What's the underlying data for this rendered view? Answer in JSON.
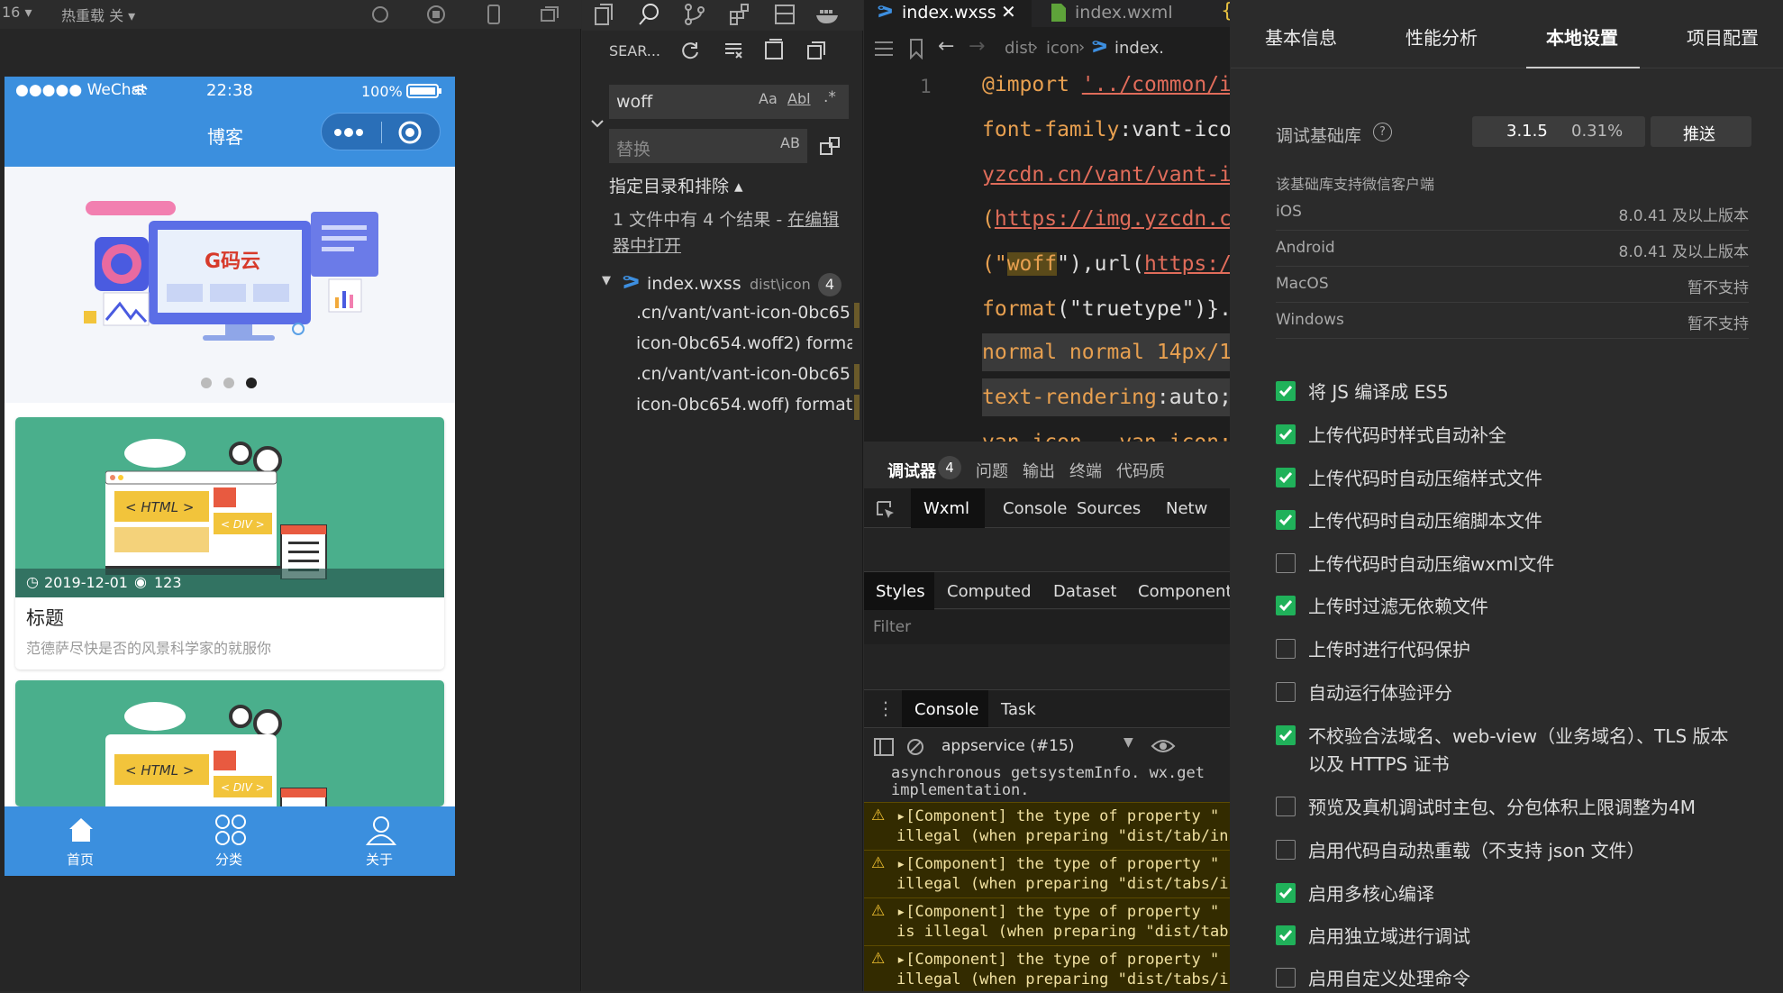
{
  "sim_toolbar": {
    "zoom": "16",
    "reload_label": "热重载 关"
  },
  "phone": {
    "carrier": "●●●●● WeChat",
    "time": "22:38",
    "battery": "100%",
    "nav_title": "博客",
    "carousel_dots": 3,
    "carousel_active": 3,
    "cards": [
      {
        "date": "2019-12-01",
        "views": "123",
        "title": "标题",
        "desc": "范德萨尽快是否的风景科学家的就服你",
        "html_tag": "< HTML >",
        "div_tag": "< DIV >"
      },
      {
        "html_tag": "< HTML >",
        "div_tag": "< DIV >"
      }
    ],
    "logo_text": "G码云",
    "tabbar": [
      {
        "label": "首页",
        "icon": "home-icon"
      },
      {
        "label": "分类",
        "icon": "grid-icon"
      },
      {
        "label": "关于",
        "icon": "user-icon"
      }
    ]
  },
  "search": {
    "header_label": "SEAR...",
    "query": "woff",
    "replace_placeholder": "替换",
    "opt_case": "Aa",
    "opt_word": "Abl",
    "opt_regex": ".*",
    "opt_preserve": "AB",
    "scope_label": "指定目录和排除",
    "summary": "1 文件中有 4 个结果 - ",
    "summary_link": "在编辑器中打开",
    "file_name": "index.wxss",
    "file_path": "dist\\icon",
    "file_count": "4",
    "results": [
      ".cn/vant/vant-icon-0bc65...",
      "icon-0bc654.woff2) forma...",
      ".cn/vant/vant-icon-0bc65...",
      "icon-0bc654.woff) format(..."
    ]
  },
  "editor": {
    "tabs": [
      {
        "label": "index.wxss",
        "active": true
      },
      {
        "label": "index.wxml",
        "active": false
      }
    ],
    "breadcrumb": [
      "dist",
      "icon",
      "index."
    ],
    "line_number": "1",
    "lines": [
      {
        "a": "@import ",
        "b": "'../common/i"
      },
      {
        "a": "font-family",
        "b": ":vant-ico"
      },
      {
        "a": "yzcdn.cn/vant/vant-i",
        "b": ""
      },
      {
        "a": "(",
        "b": "https://img.yzcdn.c"
      },
      {
        "a": "(\"",
        "b": "woff",
        "c": "\"),url(",
        "d": "https:/"
      },
      {
        "a": "format",
        "b": "(\"truetype\")}."
      },
      {
        "a": "normal normal 14px/1",
        "b": ""
      },
      {
        "a": "text-rendering",
        "b": ":auto;"
      },
      {
        "a": "van-icon, .van-icon:b",
        "b": ""
      }
    ]
  },
  "debugger": {
    "tabs": [
      "调试器",
      "问题",
      "输出",
      "终端",
      "代码质"
    ],
    "badge": "4",
    "subtabs": [
      "Wxml",
      "Console",
      "Sources",
      "Netw"
    ],
    "style_tabs": [
      "Styles",
      "Computed",
      "Dataset",
      "Component"
    ],
    "filter_placeholder": "Filter",
    "console_tabs": [
      "Console",
      "Task"
    ],
    "context": "appservice (#15)",
    "pre_line1": "asynchronous getsystemInfo. wx.get",
    "pre_line2": "implementation.",
    "warnings": [
      {
        "l1": "▸[Component] the type of property \"",
        "l2": "illegal (when preparing \"dist/tab/in"
      },
      {
        "l1": "▸[Component] the type of property \"",
        "l2": "illegal (when preparing \"dist/tabs/i"
      },
      {
        "l1": "▸[Component] the type of property \"",
        "l2": "is illegal (when preparing \"dist/tab"
      },
      {
        "l1": "▸[Component] the type of property \"",
        "l2": "illegal (when preparing \"dist/tabs/i"
      }
    ]
  },
  "settings": {
    "tabs": [
      "基本信息",
      "性能分析",
      "本地设置",
      "项目配置"
    ],
    "active_tab": 2,
    "lib_label": "调试基础库",
    "lib_version": "3.1.5",
    "lib_percent": "0.31%",
    "push_label": "推送",
    "support_title": "该基础库支持微信客户端",
    "support": [
      {
        "os": "iOS",
        "ver": "8.0.41 及以上版本"
      },
      {
        "os": "Android",
        "ver": "8.0.41 及以上版本"
      },
      {
        "os": "MacOS",
        "ver": "暂不支持"
      },
      {
        "os": "Windows",
        "ver": "暂不支持"
      }
    ],
    "options": [
      {
        "label": "将 JS 编译成 ES5",
        "checked": true
      },
      {
        "label": "上传代码时样式自动补全",
        "checked": true
      },
      {
        "label": "上传代码时自动压缩样式文件",
        "checked": true
      },
      {
        "label": "上传代码时自动压缩脚本文件",
        "checked": true
      },
      {
        "label": "上传代码时自动压缩wxml文件",
        "checked": false
      },
      {
        "label": "上传时过滤无依赖文件",
        "checked": true
      },
      {
        "label": "上传时进行代码保护",
        "checked": false
      },
      {
        "label": "自动运行体验评分",
        "checked": false
      },
      {
        "label": "不校验合法域名、web-view（业务域名）、TLS 版本以及 HTTPS 证书",
        "checked": true
      },
      {
        "label": "预览及真机调试时主包、分包体积上限调整为4M",
        "checked": false
      },
      {
        "label": "启用代码自动热重载（不支持 json 文件）",
        "checked": false
      },
      {
        "label": "启用多核心编译",
        "checked": true
      },
      {
        "label": "启用独立域进行调试",
        "checked": true
      },
      {
        "label": "启用自定义处理命令",
        "checked": false
      }
    ],
    "colors": {
      "checked": "#20b15a",
      "accent": "#3b8fde"
    }
  }
}
